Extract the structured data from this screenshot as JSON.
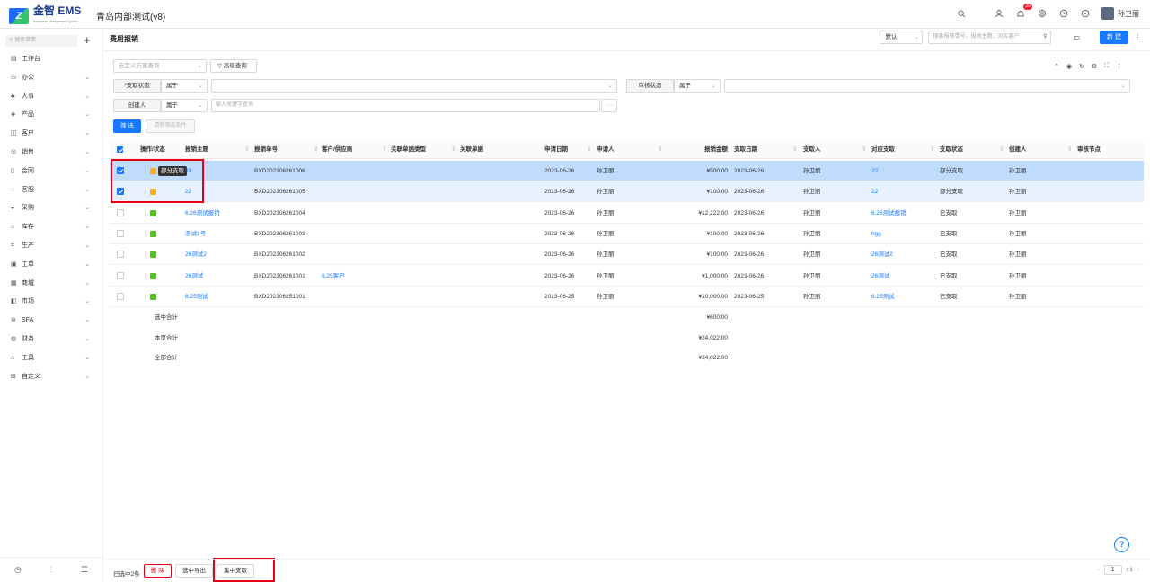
{
  "header": {
    "logo_text": "金智 EMS",
    "logo_sub": "Enterprise Management System",
    "app_title": "青岛内部测试(v8)",
    "notif_count": "20",
    "user_name": "孙卫丽"
  },
  "sidebar": {
    "search_placeholder": "搜索菜单",
    "items": [
      {
        "label": "工作台",
        "icon": "dashboard-icon",
        "glyph": "▤",
        "chev": false
      },
      {
        "label": "办公",
        "icon": "office-icon",
        "glyph": "▭",
        "chev": true
      },
      {
        "label": "人事",
        "icon": "people-icon",
        "glyph": "♣",
        "chev": true
      },
      {
        "label": "产品",
        "icon": "product-icon",
        "glyph": "◈",
        "chev": true
      },
      {
        "label": "客户",
        "icon": "customer-icon",
        "glyph": "◫",
        "chev": true
      },
      {
        "label": "销售",
        "icon": "sales-icon",
        "glyph": "◎",
        "chev": true
      },
      {
        "label": "合同",
        "icon": "contract-icon",
        "glyph": "▯",
        "chev": true
      },
      {
        "label": "客服",
        "icon": "service-icon",
        "glyph": "◌",
        "chev": true
      },
      {
        "label": "采购",
        "icon": "purchase-icon",
        "glyph": "◒",
        "chev": true
      },
      {
        "label": "库存",
        "icon": "inventory-icon",
        "glyph": "⌂",
        "chev": true
      },
      {
        "label": "生产",
        "icon": "production-icon",
        "glyph": "⌗",
        "chev": true
      },
      {
        "label": "工单",
        "icon": "workorder-icon",
        "glyph": "▣",
        "chev": true
      },
      {
        "label": "商城",
        "icon": "mall-icon",
        "glyph": "▦",
        "chev": true
      },
      {
        "label": "市场",
        "icon": "market-icon",
        "glyph": "◧",
        "chev": true
      },
      {
        "label": "SFA",
        "icon": "sfa-icon",
        "glyph": "⊛",
        "chev": true
      },
      {
        "label": "财务",
        "icon": "finance-icon",
        "glyph": "◍",
        "chev": true
      },
      {
        "label": "工具",
        "icon": "tools-icon",
        "glyph": "⌂",
        "chev": true
      },
      {
        "label": "自定义",
        "icon": "custom-icon",
        "glyph": "⊞",
        "chev": true
      }
    ]
  },
  "page": {
    "title": "费用报销",
    "view_select": "默认",
    "search_placeholder": "搜索报销单号、报销主题、对应客户",
    "new_label": "新 建"
  },
  "filters": {
    "scheme_placeholder": "自定义方案查询",
    "advanced_label": "高级查询",
    "pay_status_label": "*支取状态",
    "pay_status_op": "属于",
    "audit_status_label": "审核状态",
    "audit_status_op": "属于",
    "creator_label": "创建人",
    "creator_op": "属于",
    "creator_placeholder": "输入关键字查询",
    "filter_btn": "筛 选",
    "clear_btn": "清除筛选条件"
  },
  "table": {
    "columns": [
      "操作/状态",
      "报销主题",
      "报销单号",
      "客户/供应商",
      "关联单据类型",
      "关联单据",
      "申请日期",
      "申请人",
      "报销金额",
      "支取日期",
      "支取人",
      "对应支取",
      "支取状态",
      "创建人",
      "审核节点"
    ],
    "rows": [
      {
        "checked": true,
        "status_color": "#faad14",
        "subject": "33",
        "no": "BXD202306261006",
        "customer": "",
        "apply_date": "2023-06-26",
        "applicant": "孙卫丽",
        "amount": "¥500.00",
        "pay_date": "2023-06-26",
        "payer": "孙卫丽",
        "pay_ref": "22",
        "pay_status": "部分支取",
        "creator": "孙卫丽"
      },
      {
        "checked": true,
        "status_color": "#faad14",
        "subject": "22",
        "no": "BXD202306261005",
        "customer": "",
        "apply_date": "2023-06-26",
        "applicant": "孙卫丽",
        "amount": "¥100.00",
        "pay_date": "2023-06-26",
        "payer": "孙卫丽",
        "pay_ref": "22",
        "pay_status": "部分支取",
        "creator": "孙卫丽"
      },
      {
        "checked": false,
        "status_color": "#52c41a",
        "subject": "6.26测试报销",
        "no": "BXD202306261004",
        "customer": "",
        "apply_date": "2023-06-26",
        "applicant": "孙卫丽",
        "amount": "¥12,222.00",
        "pay_date": "2023-06-26",
        "payer": "孙卫丽",
        "pay_ref": "6.26测试报销",
        "pay_status": "已支取",
        "creator": "孙卫丽"
      },
      {
        "checked": false,
        "status_color": "#52c41a",
        "subject": "测试1号",
        "no": "BXD202306261003",
        "customer": "",
        "apply_date": "2023-06-26",
        "applicant": "孙卫丽",
        "amount": "¥100.00",
        "pay_date": "2023-06-26",
        "payer": "孙卫丽",
        "pay_ref": "hgg",
        "pay_status": "已支取",
        "creator": "孙卫丽"
      },
      {
        "checked": false,
        "status_color": "#52c41a",
        "subject": "26测试2",
        "no": "BXD202306261002",
        "customer": "",
        "apply_date": "2023-06-26",
        "applicant": "孙卫丽",
        "amount": "¥100.00",
        "pay_date": "2023-06-26",
        "payer": "孙卫丽",
        "pay_ref": "26测试2",
        "pay_status": "已支取",
        "creator": "孙卫丽"
      },
      {
        "checked": false,
        "status_color": "#52c41a",
        "subject": "26测试",
        "no": "BXD202306261001",
        "customer": "6.25客户",
        "apply_date": "2023-06-26",
        "applicant": "孙卫丽",
        "amount": "¥1,000.00",
        "pay_date": "2023-06-26",
        "payer": "孙卫丽",
        "pay_ref": "26测试",
        "pay_status": "已支取",
        "creator": "孙卫丽"
      },
      {
        "checked": false,
        "status_color": "#52c41a",
        "subject": "6.25测试",
        "no": "BXD202306251001",
        "customer": "",
        "apply_date": "2023-06-25",
        "applicant": "孙卫丽",
        "amount": "¥10,000.00",
        "pay_date": "2023-06-25",
        "payer": "孙卫丽",
        "pay_ref": "6.25测试",
        "pay_status": "已支取",
        "creator": "孙卫丽"
      }
    ],
    "tooltip": "部分支取",
    "totals": [
      {
        "label": "选中合计",
        "amount": "¥600.00"
      },
      {
        "label": "本页合计",
        "amount": "¥24,022.00"
      },
      {
        "label": "全部合计",
        "amount": "¥24,022.00"
      }
    ]
  },
  "footer": {
    "selected_text": "已选中2条",
    "delete_label": "删 除",
    "export_label": "选中导出",
    "collect_label": "集中支取",
    "page_current": "1",
    "page_total": "/ 1"
  },
  "colors": {
    "primary": "#1677ff",
    "highlight": "#e60012"
  }
}
